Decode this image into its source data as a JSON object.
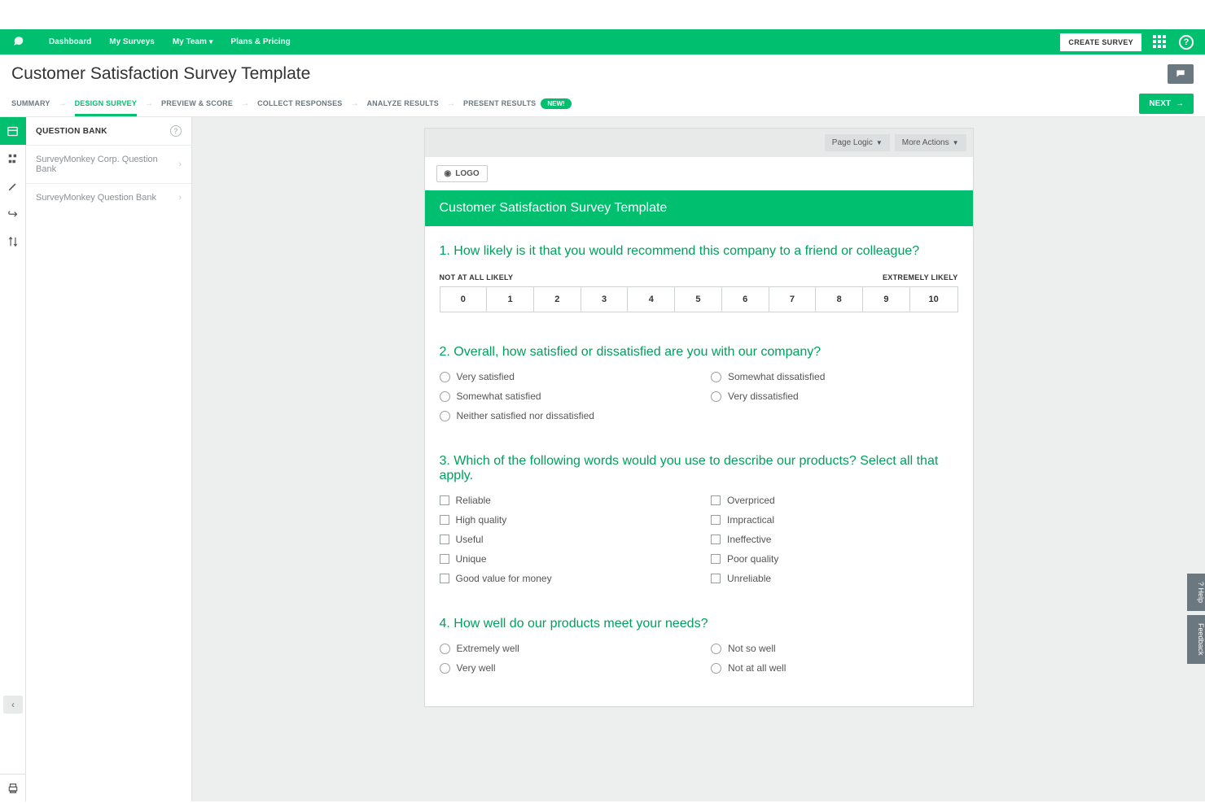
{
  "topbar": {
    "links": [
      "Dashboard",
      "My Surveys",
      "My Team",
      "Plans & Pricing"
    ],
    "create_label": "CREATE SURVEY"
  },
  "page": {
    "title": "Customer Satisfaction Survey Template"
  },
  "steps": {
    "items": [
      "SUMMARY",
      "DESIGN SURVEY",
      "PREVIEW & SCORE",
      "COLLECT RESPONSES",
      "ANALYZE RESULTS",
      "PRESENT RESULTS"
    ],
    "active_index": 1,
    "badge": "NEW!",
    "next_label": "NEXT"
  },
  "sidebar": {
    "heading": "QUESTION BANK",
    "banks": [
      "SurveyMonkey Corp. Question Bank",
      "SurveyMonkey Question Bank"
    ]
  },
  "card": {
    "page_logic_label": "Page Logic",
    "more_actions_label": "More Actions",
    "logo_label": "LOGO",
    "survey_title": "Customer Satisfaction Survey Template"
  },
  "questions": {
    "q1": {
      "num": "1.",
      "text": "How likely is it that you would recommend this company to a friend or colleague?",
      "left_label": "NOT AT ALL LIKELY",
      "right_label": "EXTREMELY LIKELY",
      "scale": [
        "0",
        "1",
        "2",
        "3",
        "4",
        "5",
        "6",
        "7",
        "8",
        "9",
        "10"
      ]
    },
    "q2": {
      "num": "2.",
      "text": "Overall, how satisfied or dissatisfied are you with our company?",
      "options_col1": [
        "Very satisfied",
        "Somewhat satisfied",
        "Neither satisfied nor dissatisfied"
      ],
      "options_col2": [
        "Somewhat dissatisfied",
        "Very dissatisfied"
      ]
    },
    "q3": {
      "num": "3.",
      "text": "Which of the following words would you use to describe our products? Select all that apply.",
      "options_col1": [
        "Reliable",
        "High quality",
        "Useful",
        "Unique",
        "Good value for money"
      ],
      "options_col2": [
        "Overpriced",
        "Impractical",
        "Ineffective",
        "Poor quality",
        "Unreliable"
      ]
    },
    "q4": {
      "num": "4.",
      "text": "How well do our products meet your needs?",
      "options_col1": [
        "Extremely well",
        "Very well"
      ],
      "options_col2": [
        "Not so well",
        "Not at all well"
      ]
    }
  },
  "float": {
    "help": "? Help",
    "feedback": "Feedback"
  }
}
